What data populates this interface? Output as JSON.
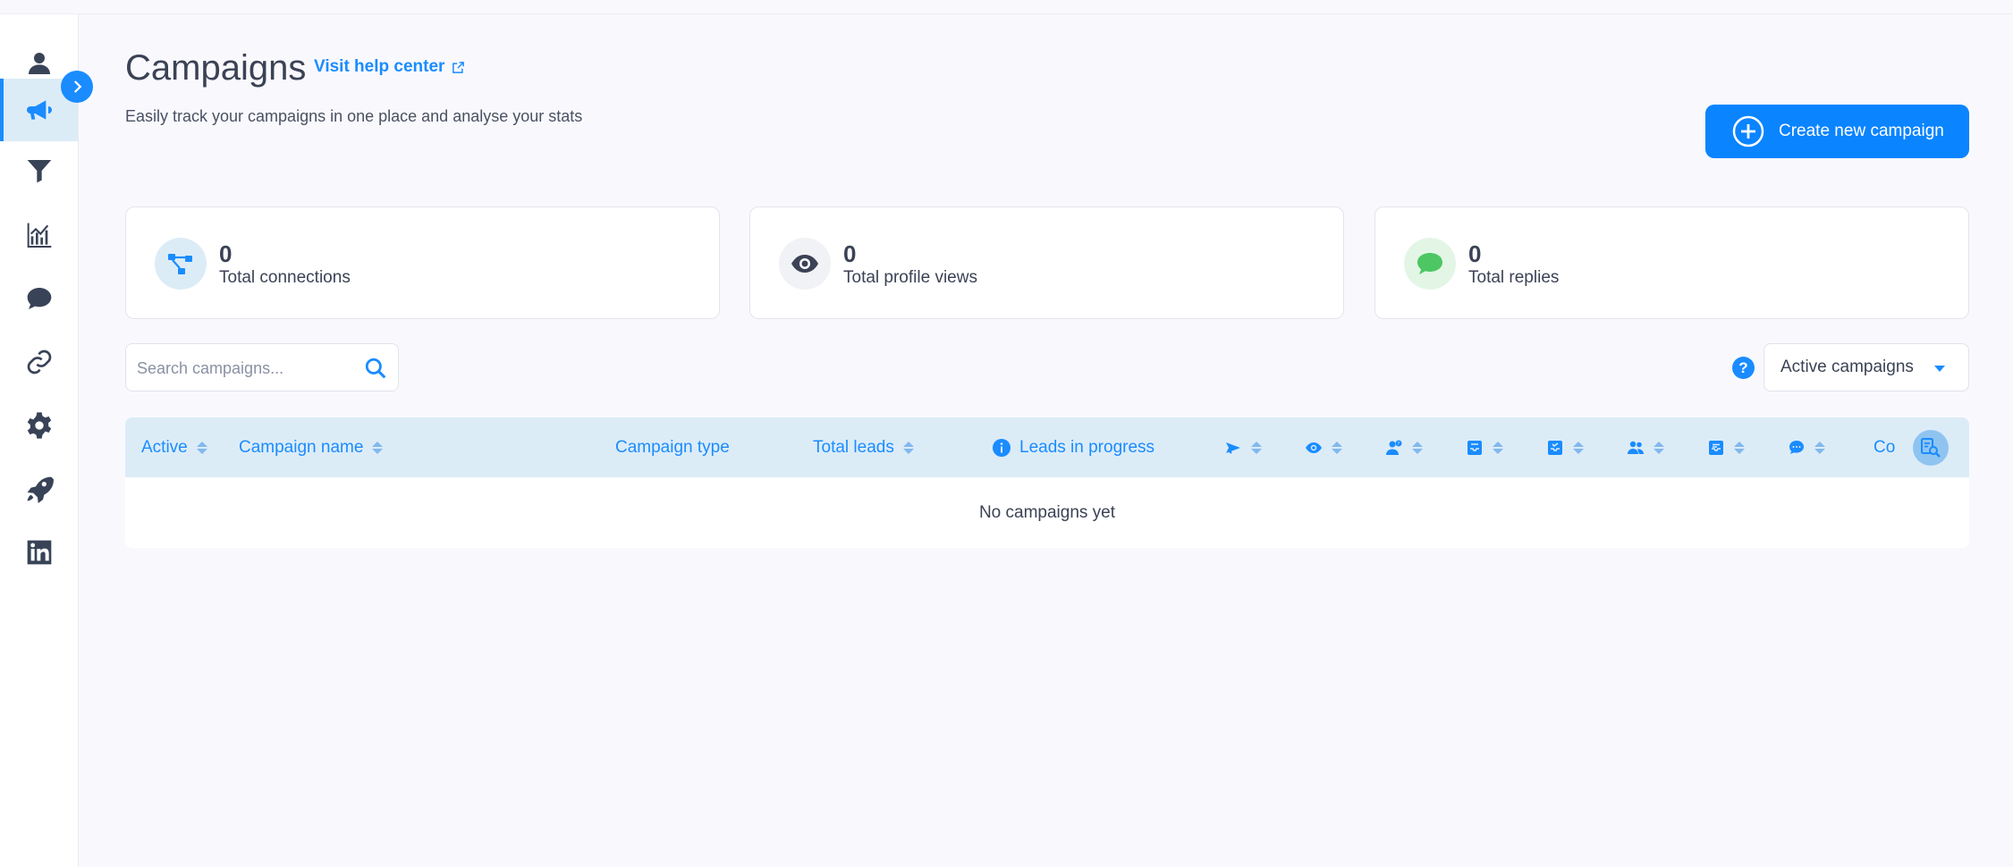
{
  "header": {
    "title": "Campaigns",
    "help_link": "Visit help center",
    "subtitle": "Easily track your campaigns in one place and analyse your stats",
    "create_button": "Create new campaign"
  },
  "sidebar": {
    "items": [
      {
        "icon": "user-icon"
      },
      {
        "icon": "megaphone-icon",
        "active": true
      },
      {
        "icon": "filter-icon"
      },
      {
        "icon": "chart-icon"
      },
      {
        "icon": "chat-icon"
      },
      {
        "icon": "link-icon"
      },
      {
        "icon": "gear-icon"
      },
      {
        "icon": "rocket-icon"
      },
      {
        "icon": "linkedin-icon"
      }
    ]
  },
  "stats": [
    {
      "value": "0",
      "label": "Total connections",
      "icon": "network-icon"
    },
    {
      "value": "0",
      "label": "Total profile views",
      "icon": "eye-icon"
    },
    {
      "value": "0",
      "label": "Total replies",
      "icon": "speech-bubble-icon"
    }
  ],
  "search": {
    "placeholder": "Search campaigns..."
  },
  "filter": {
    "selected": "Active campaigns",
    "help": "?"
  },
  "table": {
    "columns": {
      "active": "Active",
      "name": "Campaign name",
      "type": "Campaign type",
      "total_leads": "Total leads",
      "in_progress": "Leads in progress",
      "truncated": "Co"
    },
    "icon_columns": [
      "send-icon",
      "eye-icon",
      "user-question-icon",
      "inbox-icon",
      "inbox-check-icon",
      "users-icon",
      "inbox-reply-icon",
      "chat-icon"
    ],
    "empty_message": "No campaigns yet"
  },
  "colors": {
    "accent": "#1a8cff",
    "header_bg": "#dcecf7",
    "text": "#3b4255"
  }
}
